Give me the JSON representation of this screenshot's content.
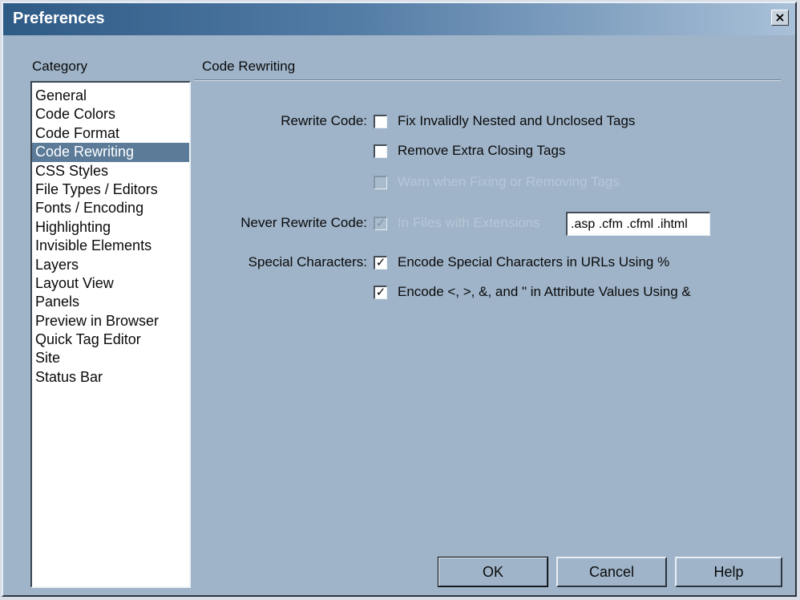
{
  "window": {
    "title": "Preferences",
    "close_glyph": "×"
  },
  "category_panel": {
    "label": "Category",
    "selected": "Code Rewriting",
    "items": [
      "General",
      "Code Colors",
      "Code Format",
      "Code Rewriting",
      "CSS Styles",
      "File Types / Editors",
      "Fonts / Encoding",
      "Highlighting",
      "Invisible Elements",
      "Layers",
      "Layout View",
      "Panels",
      "Preview in Browser",
      "Quick Tag Editor",
      "Site",
      "Status Bar"
    ]
  },
  "section": {
    "title": "Code Rewriting",
    "rewrite_code": {
      "label": "Rewrite Code:",
      "fix_nested": {
        "label": "Fix Invalidly Nested and Unclosed Tags",
        "checked": false,
        "mark": ""
      },
      "remove_closing": {
        "label": "Remove Extra Closing Tags",
        "checked": false,
        "mark": ""
      },
      "warn_fixing": {
        "label": "Warn when Fixing or Removing Tags",
        "checked": false,
        "disabled": true,
        "mark": ""
      }
    },
    "never_rewrite": {
      "label": "Never Rewrite Code:",
      "in_files": {
        "label": "In Files with Extensions",
        "checked": true,
        "disabled": true,
        "mark": "✓"
      },
      "extensions_value": ".asp .cfm .cfml .ihtml"
    },
    "special_chars": {
      "label": "Special Characters:",
      "encode_urls": {
        "label": "Encode Special Characters in URLs Using %",
        "checked": true,
        "mark": "✓"
      },
      "encode_attrs": {
        "label": "Encode <, >, &, and \" in Attribute Values Using &",
        "checked": true,
        "mark": "✓"
      }
    }
  },
  "buttons": {
    "ok": "OK",
    "cancel": "Cancel",
    "help": "Help"
  },
  "colors": {
    "dialog_bg": "#9fb4c9",
    "titlebar_dark": "#2e5a86",
    "selection": "#5b7b99"
  }
}
